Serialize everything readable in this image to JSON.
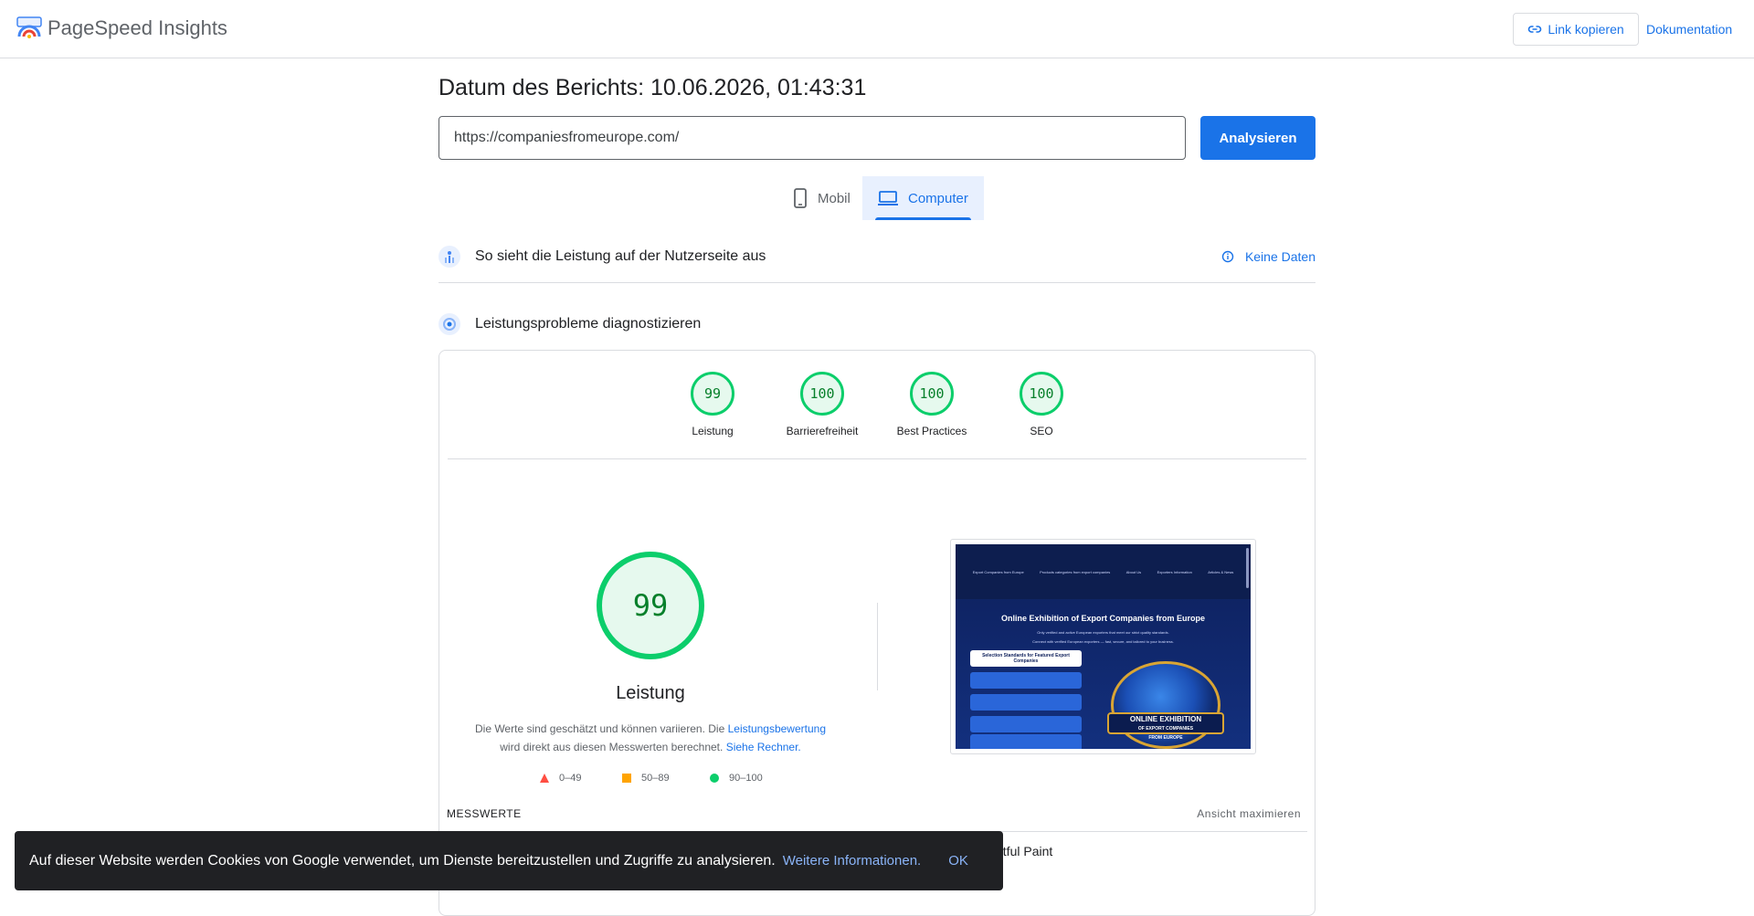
{
  "header": {
    "app_title": "PageSpeed Insights",
    "copy_link_label": "Link kopieren",
    "docs_label": "Dokumentation"
  },
  "report": {
    "date_label": "Datum des Berichts: 10.06.2026, 01:43:31"
  },
  "search": {
    "url_value": "https://companiesfromeurope.com/",
    "analyze_label": "Analysieren"
  },
  "tabs": [
    {
      "label": "Mobil",
      "icon": "phone-icon",
      "selected": false
    },
    {
      "label": "Computer",
      "icon": "laptop-icon",
      "selected": true
    }
  ],
  "field_data": {
    "title": "So sieht die Leistung auf der Nutzerseite aus",
    "no_data_label": "Keine Daten"
  },
  "diagnostics": {
    "title": "Leistungsprobleme diagnostizieren",
    "scores": [
      {
        "label": "Leistung",
        "value": "99"
      },
      {
        "label": "Barrierefreiheit",
        "value": "100"
      },
      {
        "label": "Best Practices",
        "value": "100"
      },
      {
        "label": "SEO",
        "value": "100"
      }
    ],
    "main_score": "99",
    "main_label": "Leistung",
    "desc_1": "Die Werte sind geschätzt und können variieren. Die",
    "desc_link_1": "Leistungsbewertung",
    "desc_2": "wird direkt aus diesen Messwerten berechnet.",
    "desc_link_2": "Siehe Rechner.",
    "legend": [
      {
        "range": "0–49",
        "color": "#ff4e42"
      },
      {
        "range": "50–89",
        "color": "#ffa400"
      },
      {
        "range": "90–100",
        "color": "#0cce6b"
      }
    ],
    "metrics_label": "MESSWERTE",
    "expand_label": "Ansicht maximieren",
    "metric_partial": "ntful Paint"
  },
  "screenshot": {
    "nav": [
      "Export Companies from Europe",
      "Products categories from export companies",
      "About Us",
      "Exporters Information",
      "Articles & News"
    ],
    "title": "Online Exhibition of Export Companies from Europe",
    "sub_1": "Only verified and active European exporters that meet our strict quality standards.",
    "sub_2": "Connect with verified European exporters — fast, secure, and tailored to your business.",
    "box_title": "Selection Standards for Featured Export Companies",
    "badge_1": "ONLINE EXHIBITION",
    "badge_2": "OF EXPORT COMPANIES",
    "badge_3": "FROM EUROPE"
  },
  "cookie": {
    "text": "Auf dieser Website werden Cookies von Google verwendet, um Dienste bereitzustellen und Zugriffe zu analysieren.",
    "more_label": "Weitere Informationen.",
    "ok_label": "OK"
  },
  "colors": {
    "accent": "#1a73e8",
    "pass": "#0cce6b",
    "pass_text": "#08802b"
  }
}
